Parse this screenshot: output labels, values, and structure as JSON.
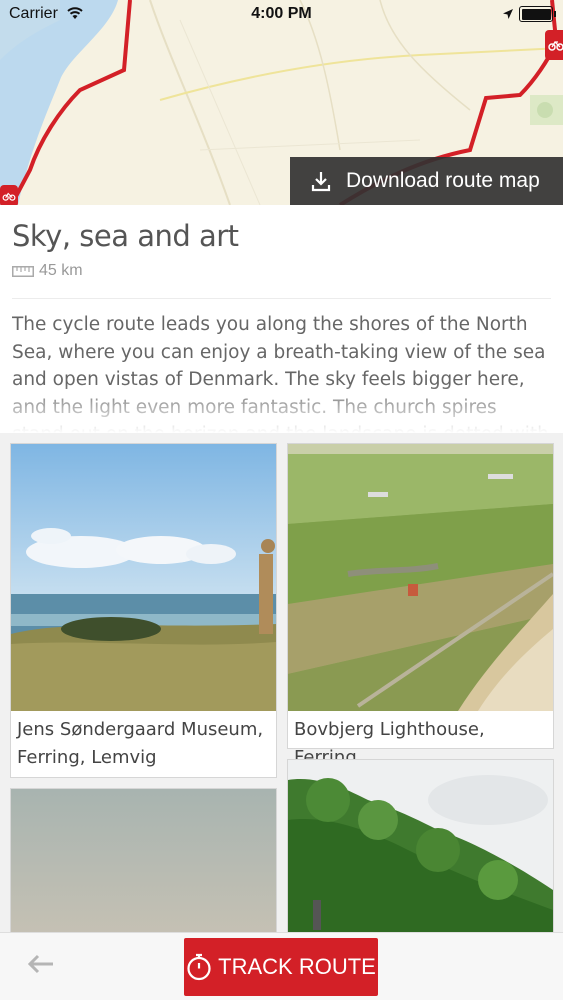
{
  "status_bar": {
    "carrier": "Carrier",
    "time": "4:00 PM"
  },
  "map": {
    "download_label": "Download route map",
    "route_color": "#d32027"
  },
  "route": {
    "title": "Sky, sea and art",
    "distance": "45 km",
    "description": "The cycle route leads you along the shores of the North Sea, where you can enjoy a breath-taking view of the sea and open vistas of Denmark. The sky feels bigger here, and the light even more fantastic. The church spires stand out on the horizon and the landscape is dotted with art."
  },
  "places": [
    {
      "caption": "Jens Søndergaard Museum, Ferring, Lemvig"
    },
    {
      "caption": "Bovbjerg Lighthouse, Ferring"
    },
    {
      "caption": ""
    },
    {
      "caption": ""
    }
  ],
  "bottom_bar": {
    "track_label": "TRACK ROUTE"
  },
  "colors": {
    "accent": "#d32027",
    "dark_overlay": "#323232"
  }
}
